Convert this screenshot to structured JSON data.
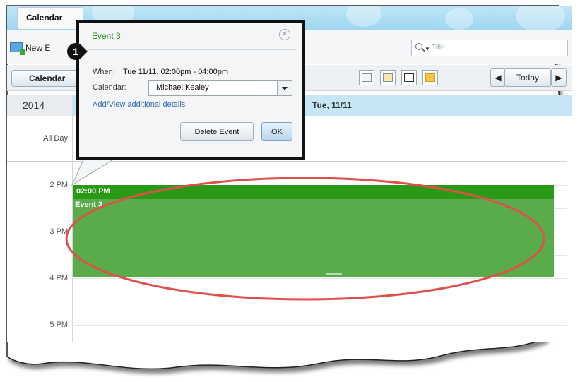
{
  "header": {
    "tab_label": "Calendar"
  },
  "toolbar": {
    "new_label": "New E",
    "search_placeholder": "Title"
  },
  "toolbar2": {
    "calendar_label": "Calendar",
    "today_label": "Today",
    "prev_arrow": "◀",
    "next_arrow": "▶"
  },
  "date_header": {
    "year": "2014",
    "day": "Tue, 11/11"
  },
  "grid": {
    "allday_label": "All Day",
    "times": [
      "2 PM",
      "3 PM",
      "4 PM",
      "5 PM"
    ]
  },
  "event": {
    "time_label": "02:00 PM",
    "title": "Event 3",
    "color": "#5aab4a",
    "header_color": "#2a9a16"
  },
  "popup": {
    "title": "Event 3",
    "when_label": "When:",
    "when_value": "Tue 11/11, 02:00pm - 04:00pm",
    "calendar_label": "Calendar:",
    "calendar_value": "Michael Kealey",
    "details_link": "Add/View additional details",
    "delete_label": "Delete Event",
    "ok_label": "OK"
  },
  "callout": {
    "number": "1"
  },
  "annotation_color": "#e0504a"
}
